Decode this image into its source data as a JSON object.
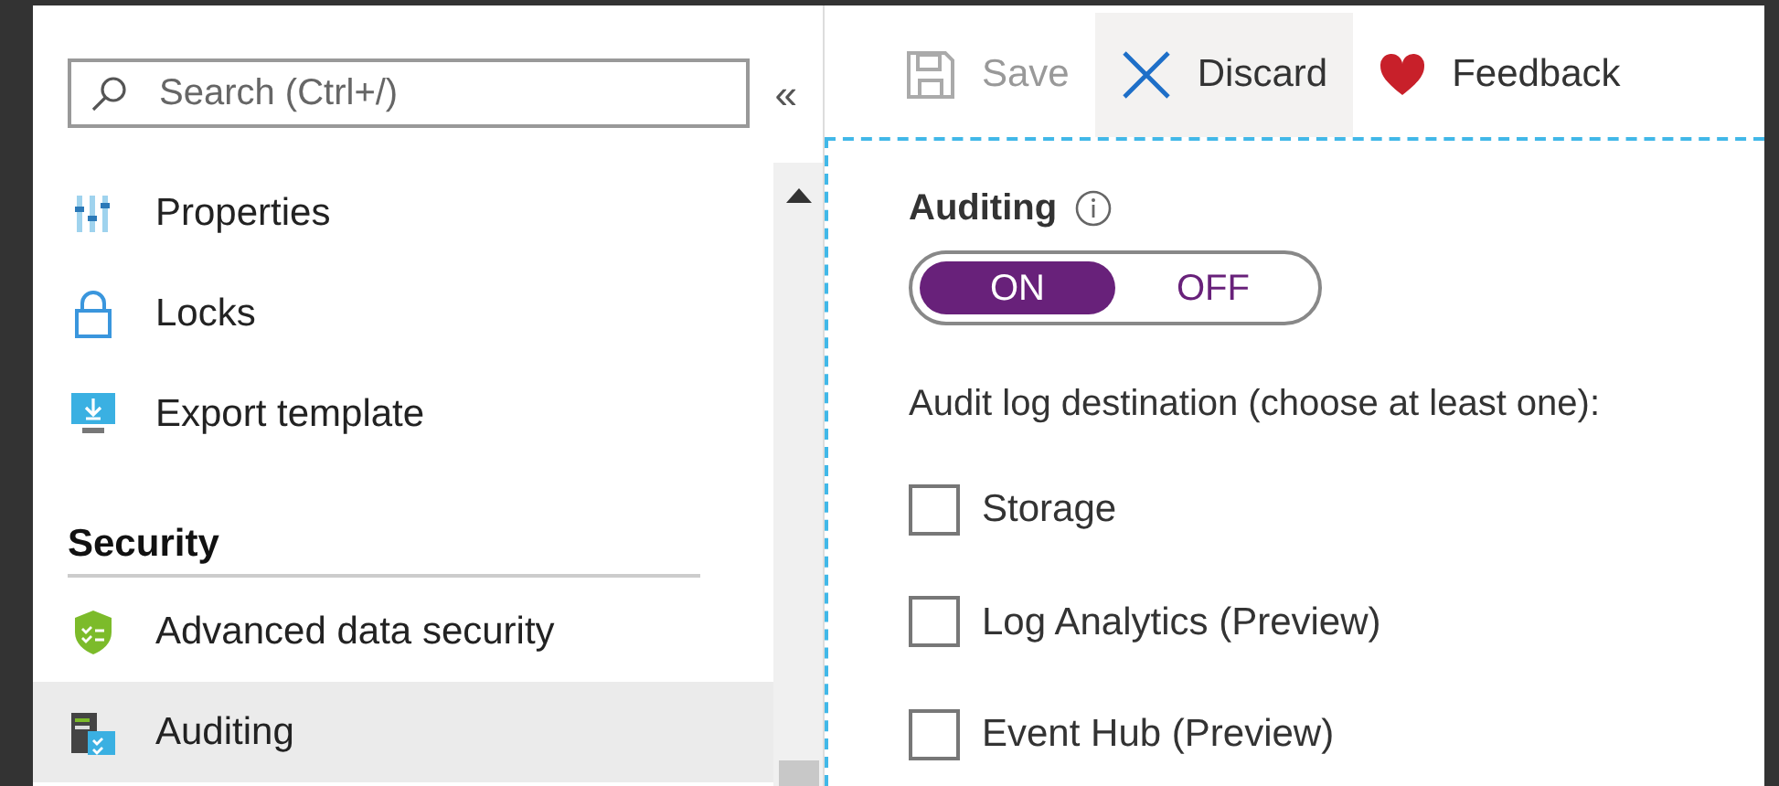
{
  "sidebar": {
    "search": {
      "placeholder": "Search (Ctrl+/)"
    },
    "collapse": "«",
    "items": [
      {
        "kind": "properties",
        "label": "Properties",
        "selected": false
      },
      {
        "kind": "lock",
        "label": "Locks",
        "selected": false
      },
      {
        "kind": "export",
        "label": "Export template",
        "selected": false
      }
    ],
    "section": {
      "title": "Security",
      "items": [
        {
          "kind": "shield",
          "label": "Advanced data security",
          "selected": false
        },
        {
          "kind": "audit",
          "label": "Auditing",
          "selected": true
        }
      ]
    }
  },
  "toolbar": [
    {
      "kind": "save",
      "label": "Save",
      "disabled": true,
      "hovered": false
    },
    {
      "kind": "discard",
      "label": "Discard",
      "disabled": false,
      "hovered": true
    },
    {
      "kind": "feedback",
      "label": "Feedback",
      "disabled": false,
      "hovered": false
    }
  ],
  "auditing": {
    "label": "Auditing",
    "toggle": [
      {
        "label": "ON",
        "selected": true
      },
      {
        "label": "OFF",
        "selected": false
      }
    ],
    "destination_label": "Audit log destination (choose at least one):",
    "destinations": [
      {
        "label": "Storage",
        "checked": false
      },
      {
        "label": "Log Analytics (Preview)",
        "checked": false
      },
      {
        "label": "Event Hub (Preview)",
        "checked": false
      }
    ]
  }
}
